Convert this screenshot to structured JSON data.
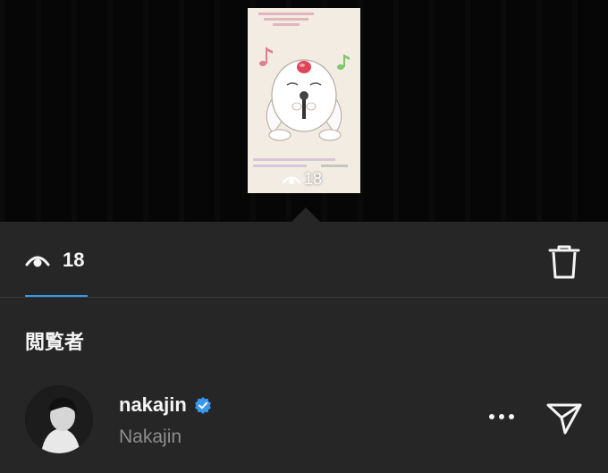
{
  "story": {
    "view_count_overlay": "18"
  },
  "stats": {
    "view_count": "18"
  },
  "viewers_section": {
    "title": "閲覧者"
  },
  "viewers": [
    {
      "username": "nakajin",
      "full_name": "Nakajin",
      "verified": true
    }
  ],
  "colors": {
    "accent": "#3897f0",
    "background": "#262626",
    "secondary_text": "#8e8e8e"
  },
  "icons": [
    "eye-icon",
    "trash-icon",
    "verified-badge-icon",
    "more-icon",
    "send-icon"
  ]
}
